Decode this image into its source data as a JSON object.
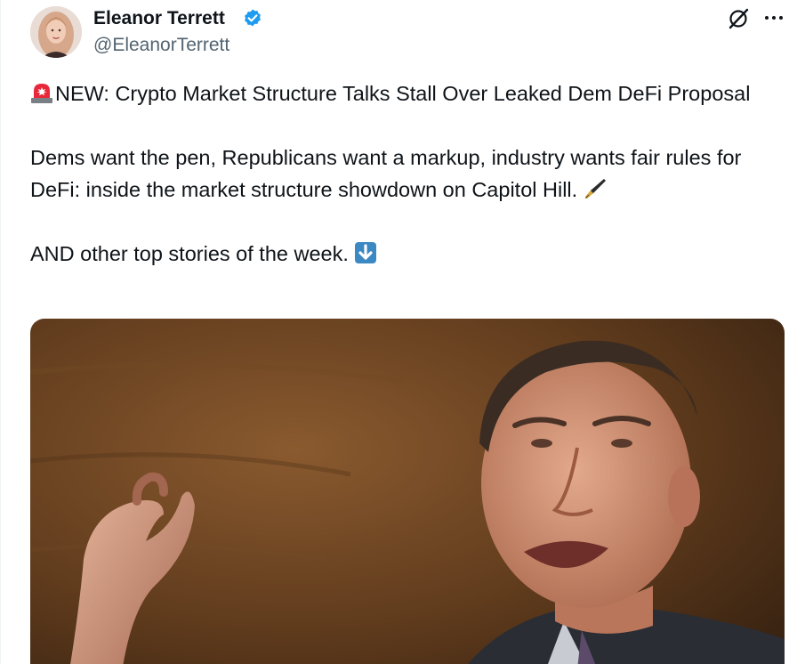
{
  "author": {
    "name": "Eleanor Terrett",
    "handle": "@EleanorTerrett",
    "verified": true,
    "verified_color": "#1d9bf0"
  },
  "header_icons": [
    "grok-icon",
    "more-icon"
  ],
  "tweet": {
    "headline_emoji": "rotating-light-icon",
    "headline": "NEW: Crypto Market Structure Talks Stall Over Leaked Dem DeFi Proposal",
    "paragraph2": "Dems want the pen, Republicans want a markup, industry wants fair rules for DeFi: inside the market structure showdown on Capitol Hill.",
    "paragraph2_emoji": "fountain-pen-icon",
    "paragraph3": "AND other top stories of the week.",
    "paragraph3_emoji": "down-arrow-icon"
  },
  "media": {
    "type": "photo",
    "colors": {
      "background": "#6a4322",
      "suit": "#2b2e36",
      "skin": "#c98a6e"
    }
  }
}
